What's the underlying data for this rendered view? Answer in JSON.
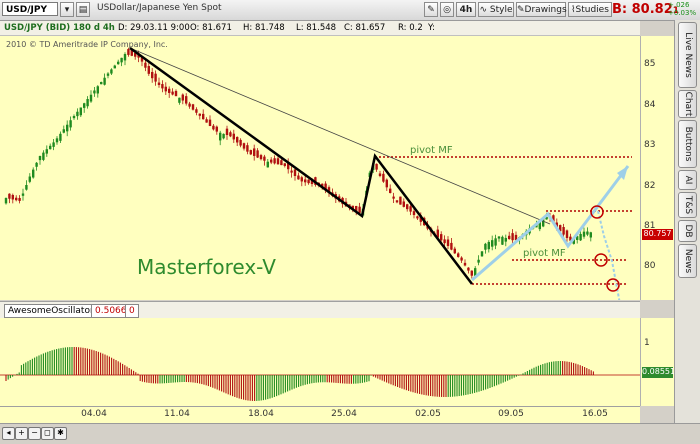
{
  "toolbar": {
    "symbol": "USD/JPY",
    "description": "USDollar/Japanese Yen Spot",
    "timeframe": "4h",
    "style_label": "Style",
    "drawings_label": "Drawings",
    "studies_label": "Studies",
    "bid_label": "B:",
    "bid_price": "80.82",
    "bid_price_last_digit": "1",
    "change": "+.026",
    "change_pct": "+0.03%"
  },
  "info": {
    "title": "USD/JPY (BID) 180 d 4h",
    "date": "D: 29.03.11 9:00",
    "open": "O: 81.671",
    "high": "H: 81.748",
    "low": "L: 81.548",
    "close": "C: 81.657",
    "range": "R: 0.2",
    "y": "Y:"
  },
  "chart": {
    "copyright": "2010 © TD Ameritrade IP Company, Inc.",
    "watermark": "Masterforex-V",
    "annotation_upper": "pivot MF",
    "annotation_lower": "pivot MF",
    "price_ticks": [
      "85",
      "84",
      "83",
      "82",
      "81",
      "80"
    ],
    "current_price_tag": "80.757",
    "date_ticks": [
      "04.04",
      "11.04",
      "18.04",
      "25.04",
      "02.05",
      "09.05",
      "16.05"
    ]
  },
  "oscillator": {
    "name": "AwesomeOscillator",
    "value": "0.5066",
    "param": "0",
    "scale_tick": "1",
    "current_value_tag": "0.08551"
  },
  "right_tabs": [
    "Live News",
    "Chart",
    "Buttons",
    "AI",
    "T&S",
    "DB",
    "News"
  ],
  "colors": {
    "background": "#ffffbf",
    "bull_candle": "#1f8a1f",
    "bear_candle": "#b01010",
    "bid_red": "#c00000",
    "pivot_line": "#b00000",
    "trend_arrow": "#9ecfe8",
    "watermark": "#2e8b2e"
  }
}
